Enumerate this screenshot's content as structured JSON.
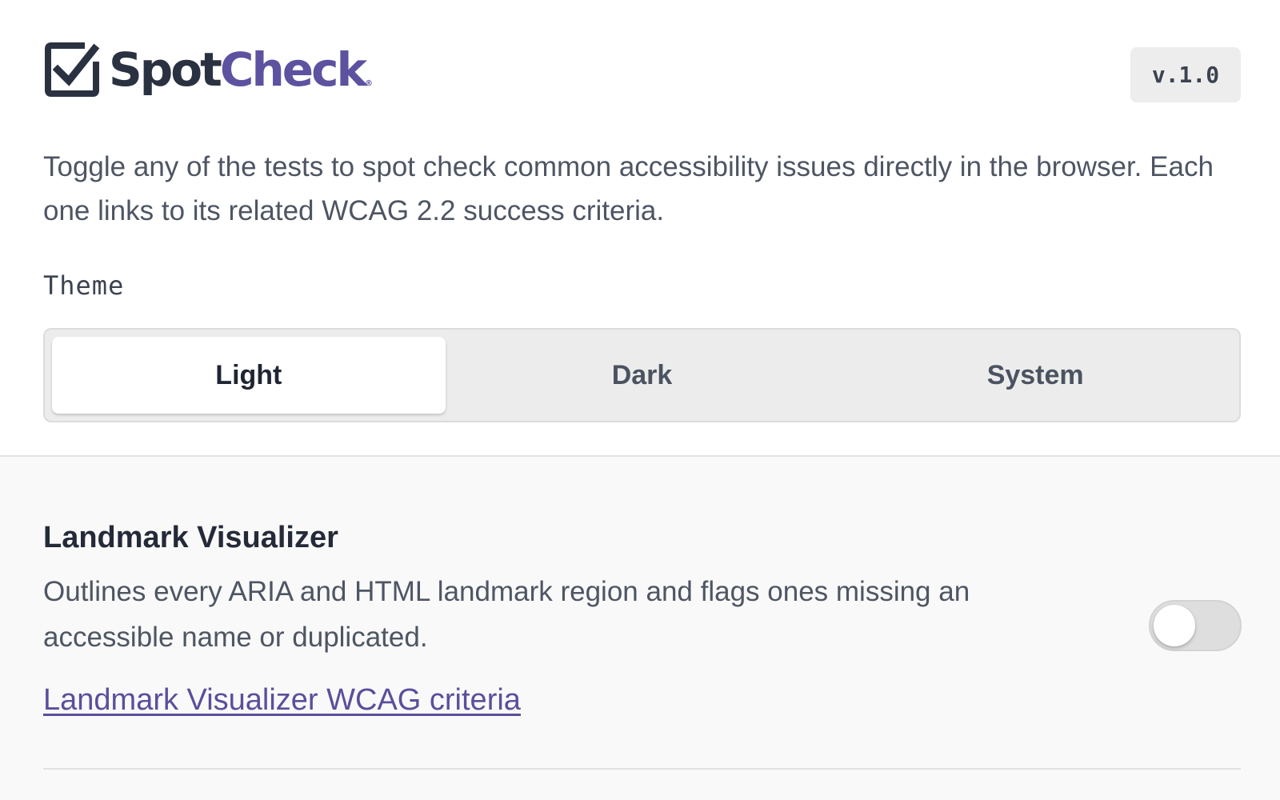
{
  "brand": {
    "name_part1": "Spot",
    "name_part2": "Check",
    "registered_mark": "®",
    "logo_icon": "checkbox-check-icon",
    "colors": {
      "dark": "#2a3140",
      "accent": "#5c52a0"
    }
  },
  "version": "v.1.0",
  "intro": "Toggle any of the tests to spot check common accessibility issues directly in the browser. Each one links to its related WCAG 2.2 success criteria.",
  "theme": {
    "label": "Theme",
    "options": [
      "Light",
      "Dark",
      "System"
    ],
    "selected": "Light"
  },
  "tools": [
    {
      "title": "Landmark Visualizer",
      "description": "Outlines every ARIA and HTML landmark region and flags ones missing an accessible name or duplicated.",
      "link_label": "Landmark Visualizer WCAG criteria",
      "enabled": false
    }
  ]
}
